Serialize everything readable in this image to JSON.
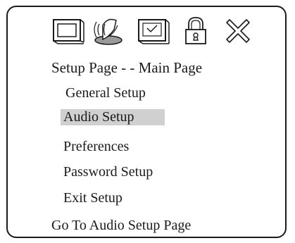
{
  "header": {
    "title": "Setup Page - - Main Page"
  },
  "tabs": [
    {
      "icon": "monitor-icon"
    },
    {
      "icon": "speaker-icon"
    },
    {
      "icon": "checkbox-preferences-icon"
    },
    {
      "icon": "lock-icon"
    },
    {
      "icon": "exit-x-icon"
    }
  ],
  "menu": {
    "items": [
      {
        "label": "General Setup",
        "selected": false
      },
      {
        "label": "Audio Setup",
        "selected": true
      },
      {
        "label": "Preferences",
        "selected": false
      },
      {
        "label": "Password Setup",
        "selected": false
      },
      {
        "label": "Exit Setup",
        "selected": false
      }
    ]
  },
  "status": {
    "text": "Go To Audio Setup Page"
  },
  "colors": {
    "highlight": "#d0d0d0",
    "line": "#1a1a1a",
    "speaker_fill": "#9a9a9a"
  }
}
